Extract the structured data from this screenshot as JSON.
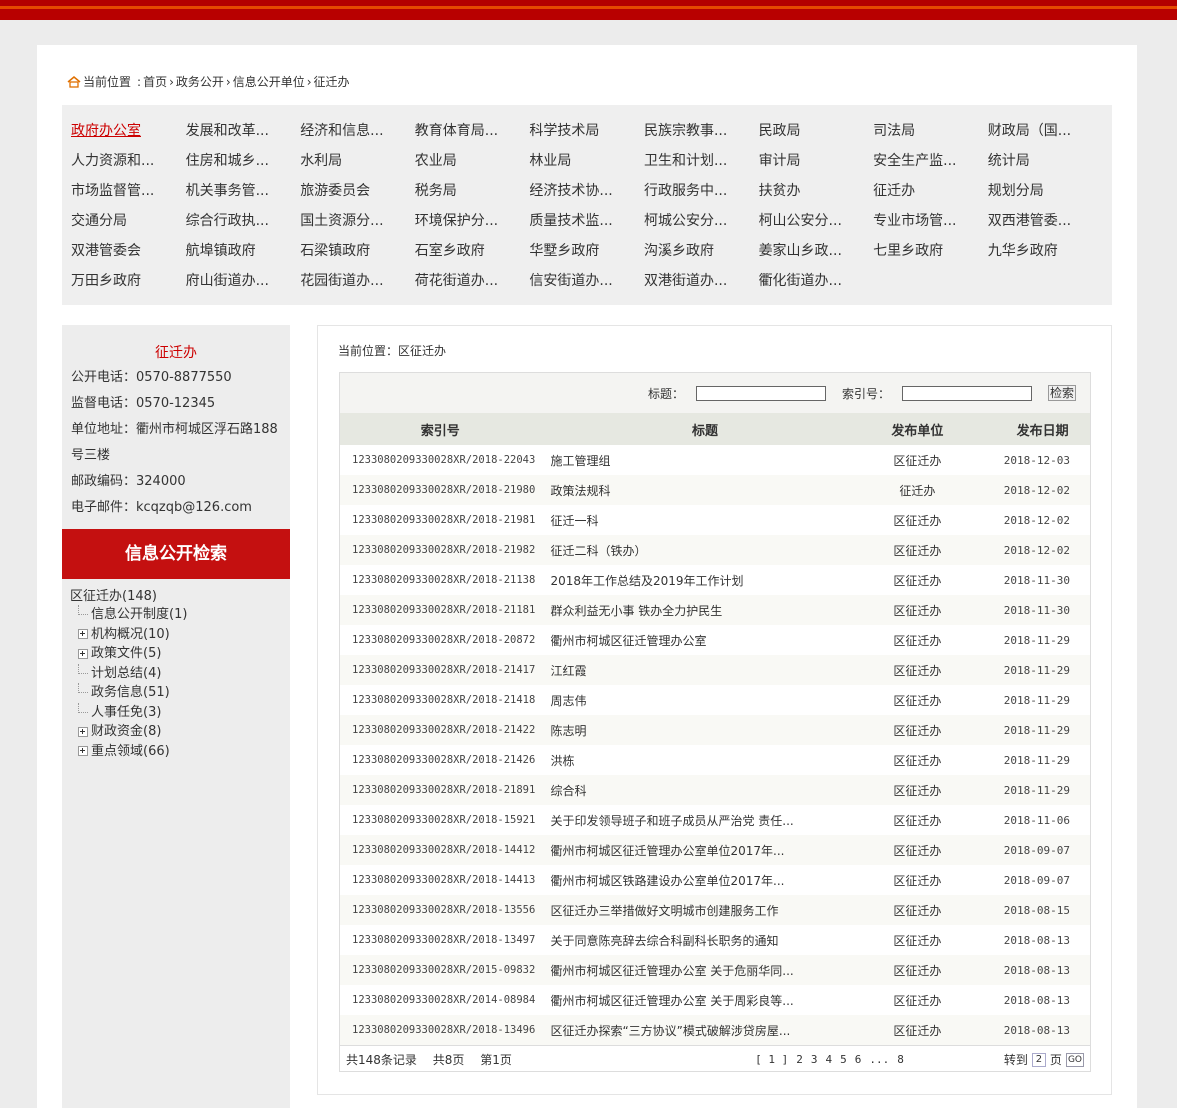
{
  "breadcrumb": {
    "prefix": "当前位置",
    "sep": ":",
    "items": [
      "首页",
      "政务公开",
      "信息公开单位",
      "征迁办"
    ]
  },
  "units": [
    "政府办公室",
    "发展和改革...",
    "经济和信息...",
    "教育体育局...",
    "科学技术局",
    "民族宗教事...",
    "民政局",
    "司法局",
    "财政局（国...",
    "人力资源和...",
    "住房和城乡...",
    "水利局",
    "农业局",
    "林业局",
    "卫生和计划...",
    "审计局",
    "安全生产监...",
    "统计局",
    "市场监督管...",
    "机关事务管...",
    "旅游委员会",
    "税务局",
    "经济技术协...",
    "行政服务中...",
    "扶贫办",
    "征迁办",
    "规划分局",
    "交通分局",
    "综合行政执...",
    "国土资源分...",
    "环境保护分...",
    "质量技术监...",
    "柯城公安分...",
    "柯山公安分...",
    "专业市场管...",
    "双西港管委...",
    "双港管委会",
    "航埠镇政府",
    "石梁镇政府",
    "石室乡政府",
    "华墅乡政府",
    "沟溪乡政府",
    "姜家山乡政...",
    "七里乡政府",
    "九华乡政府",
    "万田乡政府",
    "府山街道办...",
    "花园街道办...",
    "荷花街道办...",
    "信安街道办...",
    "双港街道办...",
    "衢化街道办..."
  ],
  "left": {
    "title": "征迁办",
    "info": [
      "公开电话：0570-8877550",
      "监督电话：0570-12345",
      "单位地址：衢州市柯城区浮石路188号三楼",
      "邮政编码：324000",
      "电子邮件：kcqzqb@126.com"
    ],
    "search_title": "信息公开检索",
    "tree_root": "区征迁办(148)",
    "tree": [
      {
        "label": "信息公开制度(1)",
        "expandable": false
      },
      {
        "label": "机构概况(10)",
        "expandable": true
      },
      {
        "label": "政策文件(5)",
        "expandable": true
      },
      {
        "label": "计划总结(4)",
        "expandable": false
      },
      {
        "label": "政务信息(51)",
        "expandable": false
      },
      {
        "label": "人事任免(3)",
        "expandable": false
      },
      {
        "label": "财政资金(8)",
        "expandable": true
      },
      {
        "label": "重点领域(66)",
        "expandable": true
      }
    ]
  },
  "right": {
    "crumb": "当前位置：区征迁办",
    "search": {
      "title_label": "标题：",
      "index_label": "索引号：",
      "button": "检索"
    },
    "headers": {
      "index": "索引号",
      "title": "标题",
      "unit": "发布单位",
      "date": "发布日期"
    },
    "rows": [
      {
        "index": "1233080209330028XR/2018-22043",
        "title": "施工管理组",
        "unit": "区征迁办",
        "date": "2018-12-03"
      },
      {
        "index": "1233080209330028XR/2018-21980",
        "title": "政策法规科",
        "unit": "征迁办",
        "date": "2018-12-02"
      },
      {
        "index": "1233080209330028XR/2018-21981",
        "title": "征迁一科",
        "unit": "区征迁办",
        "date": "2018-12-02"
      },
      {
        "index": "1233080209330028XR/2018-21982",
        "title": "征迁二科（铁办）",
        "unit": "区征迁办",
        "date": "2018-12-02"
      },
      {
        "index": "1233080209330028XR/2018-21138",
        "title": "2018年工作总结及2019年工作计划",
        "unit": "区征迁办",
        "date": "2018-11-30"
      },
      {
        "index": "1233080209330028XR/2018-21181",
        "title": "群众利益无小事 铁办全力护民生",
        "unit": "区征迁办",
        "date": "2018-11-30"
      },
      {
        "index": "1233080209330028XR/2018-20872",
        "title": "衢州市柯城区征迁管理办公室",
        "unit": "区征迁办",
        "date": "2018-11-29"
      },
      {
        "index": "1233080209330028XR/2018-21417",
        "title": "江红霞",
        "unit": "区征迁办",
        "date": "2018-11-29"
      },
      {
        "index": "1233080209330028XR/2018-21418",
        "title": "周志伟",
        "unit": "区征迁办",
        "date": "2018-11-29"
      },
      {
        "index": "1233080209330028XR/2018-21422",
        "title": "陈志明",
        "unit": "区征迁办",
        "date": "2018-11-29"
      },
      {
        "index": "1233080209330028XR/2018-21426",
        "title": "洪栋",
        "unit": "区征迁办",
        "date": "2018-11-29"
      },
      {
        "index": "1233080209330028XR/2018-21891",
        "title": "综合科",
        "unit": "区征迁办",
        "date": "2018-11-29"
      },
      {
        "index": "1233080209330028XR/2018-15921",
        "title": "关于印发领导班子和班子成员从严治党 责任...",
        "unit": "区征迁办",
        "date": "2018-11-06"
      },
      {
        "index": "1233080209330028XR/2018-14412",
        "title": "衢州市柯城区征迁管理办公室单位2017年...",
        "unit": "区征迁办",
        "date": "2018-09-07"
      },
      {
        "index": "1233080209330028XR/2018-14413",
        "title": "衢州市柯城区铁路建设办公室单位2017年...",
        "unit": "区征迁办",
        "date": "2018-09-07"
      },
      {
        "index": "1233080209330028XR/2018-13556",
        "title": "区征迁办三举措做好文明城市创建服务工作",
        "unit": "区征迁办",
        "date": "2018-08-15"
      },
      {
        "index": "1233080209330028XR/2018-13497",
        "title": "关于同意陈亮辞去综合科副科长职务的通知",
        "unit": "区征迁办",
        "date": "2018-08-13"
      },
      {
        "index": "1233080209330028XR/2015-09832",
        "title": "衢州市柯城区征迁管理办公室 关于危丽华同...",
        "unit": "区征迁办",
        "date": "2018-08-13"
      },
      {
        "index": "1233080209330028XR/2014-08984",
        "title": "衢州市柯城区征迁管理办公室 关于周彩良等...",
        "unit": "区征迁办",
        "date": "2018-08-13"
      },
      {
        "index": "1233080209330028XR/2018-13496",
        "title": "区征迁办探索“三方协议”模式破解涉贷房屋...",
        "unit": "区征迁办",
        "date": "2018-08-13"
      }
    ],
    "pager": {
      "total": "共148条记录",
      "pages": "共8页",
      "current": "第1页",
      "links": [
        "[ 1 ]",
        "2",
        "3",
        "4",
        "5",
        "6",
        "...",
        "8"
      ],
      "goto_label": "转到",
      "goto_value": "2",
      "page_label": "页",
      "go": "GO"
    }
  },
  "colors": {
    "brand_red": "#c41010",
    "active_link": "#cc0000"
  }
}
